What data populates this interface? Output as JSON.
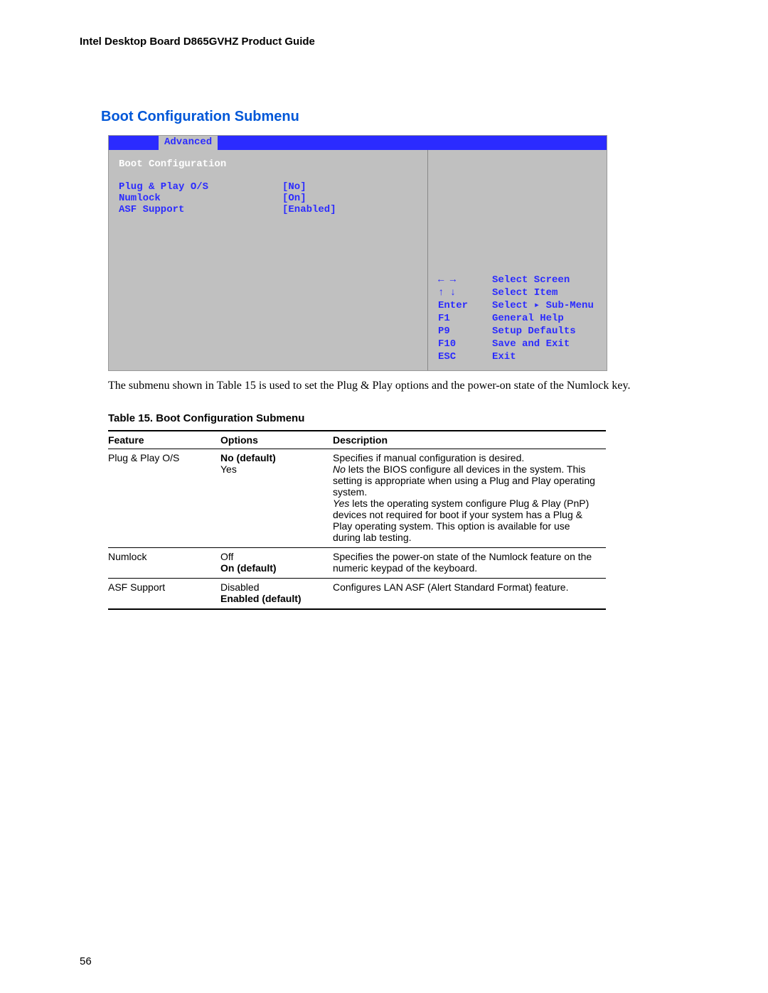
{
  "doc_header": "Intel Desktop Board D865GVHZ Product Guide",
  "section_heading": "Boot Configuration Submenu",
  "bios": {
    "tab_active": "Advanced",
    "submenu_title": "Boot Configuration",
    "items": [
      {
        "label": "Plug & Play O/S",
        "value": "[No]"
      },
      {
        "label": "Numlock",
        "value": "[On]"
      },
      {
        "label": "ASF Support",
        "value": "[Enabled]"
      }
    ],
    "legend": [
      {
        "key": "←  →",
        "desc": "Select Screen"
      },
      {
        "key": "↑ ↓",
        "desc": "Select Item"
      },
      {
        "key": "Enter",
        "desc": "Select ▸ Sub-Menu"
      },
      {
        "key": "F1",
        "desc": "General Help"
      },
      {
        "key": "P9",
        "desc": "Setup Defaults"
      },
      {
        "key": "F10",
        "desc": "Save and Exit"
      },
      {
        "key": "ESC",
        "desc": "Exit"
      }
    ]
  },
  "body_text": "The submenu shown in Table 15 is used to set the Plug & Play options and the power-on state of the Numlock key.",
  "table_caption": "Table 15.    Boot Configuration Submenu",
  "table": {
    "headers": {
      "feature": "Feature",
      "options": "Options",
      "description": "Description"
    },
    "rows": [
      {
        "feature": "Plug & Play O/S",
        "options": [
          {
            "text": "No (default)",
            "default": true
          },
          {
            "text": "Yes",
            "default": false
          }
        ],
        "description": {
          "line1": "Specifies if manual configuration is desired.",
          "em1": "No",
          "line2": " lets the BIOS configure all devices in the system.  This setting is appropriate when using a Plug and Play operating system.",
          "em2": "Yes",
          "line3": " lets the operating system configure Plug & Play (PnP) devices not required for boot if your system has a Plug & Play operating system.  This option is available for use during lab testing."
        }
      },
      {
        "feature": "Numlock",
        "options": [
          {
            "text": "Off",
            "default": false
          },
          {
            "text": "On (default)",
            "default": true
          }
        ],
        "description_plain": "Specifies the power-on state of the Numlock feature on the numeric keypad of the keyboard."
      },
      {
        "feature": "ASF Support",
        "options": [
          {
            "text": "Disabled",
            "default": false
          },
          {
            "text": "Enabled (default)",
            "default": true
          }
        ],
        "description_plain": "Configures LAN ASF (Alert Standard Format) feature."
      }
    ]
  },
  "page_number": "56"
}
